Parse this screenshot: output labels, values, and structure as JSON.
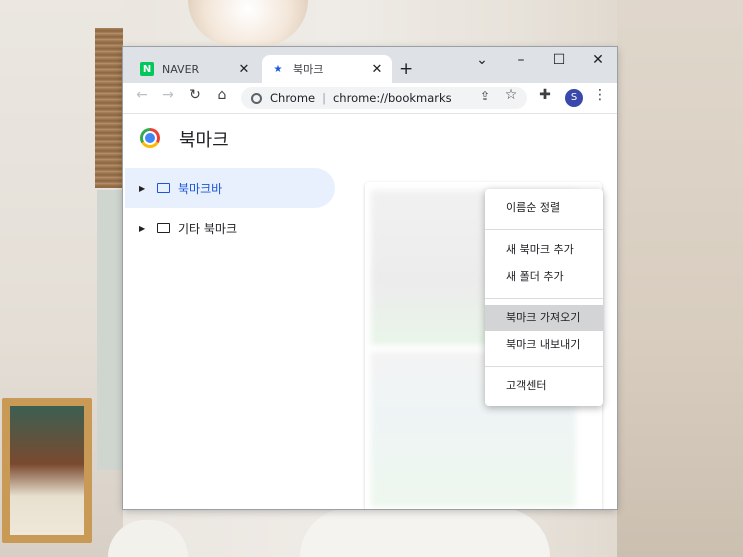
{
  "tabs": [
    {
      "label": "NAVER",
      "favicon": "naver-icon",
      "favicon_text": "N"
    },
    {
      "label": "북마크",
      "favicon": "star-icon",
      "favicon_text": "★"
    }
  ],
  "toolbar": {
    "site_label": "Chrome",
    "url": "chrome://bookmarks",
    "profile_initial": "S"
  },
  "page": {
    "title": "북마크"
  },
  "folders": [
    {
      "label": "북마크바",
      "selected": true
    },
    {
      "label": "기타 북마크",
      "selected": false
    }
  ],
  "menu": {
    "items": [
      {
        "label": "이름순 정렬"
      },
      {
        "label": "새 북마크 추가"
      },
      {
        "label": "새 폴더 추가"
      },
      {
        "label": "북마크 가져오기",
        "highlighted": true
      },
      {
        "label": "북마크 내보내기"
      },
      {
        "label": "고객센터"
      }
    ]
  },
  "colors": {
    "accent": "#1a56db",
    "naver_green": "#03c75a",
    "selected_bg": "#e8f0fe",
    "menu_highlight": "#d3d4d6"
  }
}
